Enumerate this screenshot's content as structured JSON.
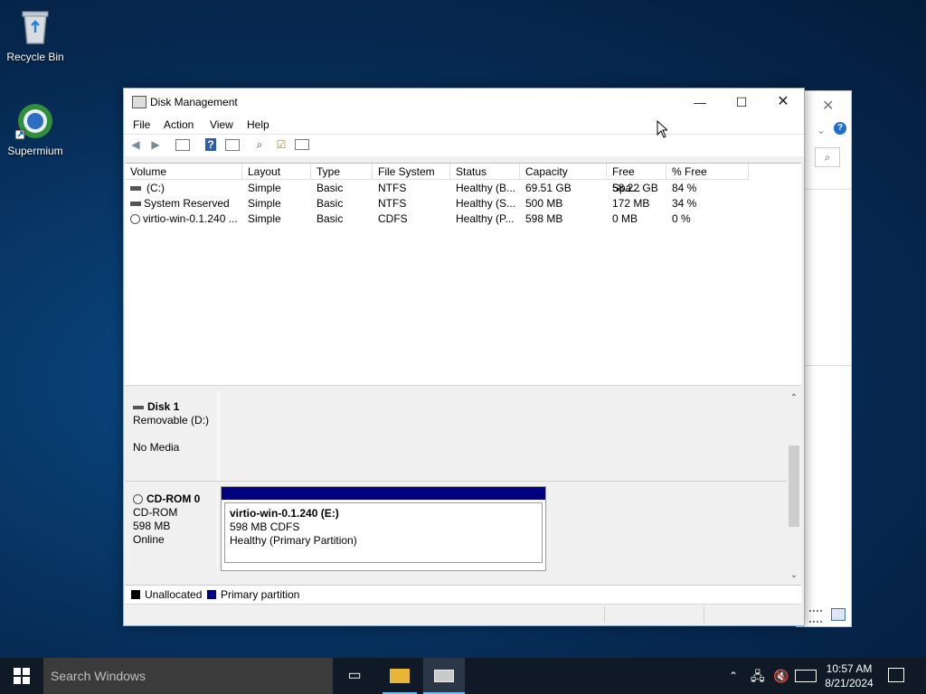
{
  "desktop": {
    "icons": [
      {
        "label": "Recycle Bin"
      },
      {
        "label": "Supermium"
      }
    ]
  },
  "window": {
    "title": "Disk Management",
    "menu": [
      "File",
      "Action",
      "View",
      "Help"
    ],
    "toolbar": [
      "back-icon",
      "forward-icon",
      "properties-icon",
      "help-icon",
      "console-tree-icon",
      "rescan-icon",
      "check-icon",
      "settings-icon"
    ]
  },
  "volumes": {
    "columns": [
      "Volume",
      "Layout",
      "Type",
      "File System",
      "Status",
      "Capacity",
      "Free Spa...",
      "% Free"
    ],
    "rows": [
      [
        "(C:)",
        "Simple",
        "Basic",
        "NTFS",
        "Healthy (B...",
        "69.51 GB",
        "58.22 GB",
        "84 %"
      ],
      [
        "System Reserved",
        "Simple",
        "Basic",
        "NTFS",
        "Healthy (S...",
        "500 MB",
        "172 MB",
        "34 %"
      ],
      [
        "virtio-win-0.1.240 ...",
        "Simple",
        "Basic",
        "CDFS",
        "Healthy (P...",
        "598 MB",
        "0 MB",
        "0 %"
      ]
    ]
  },
  "disks": [
    {
      "name": "Disk 1",
      "line1": "Removable (D:)",
      "line2": "",
      "line3": "No Media"
    },
    {
      "name": "CD-ROM 0",
      "line1": "CD-ROM",
      "line2": "598 MB",
      "line3": "Online"
    }
  ],
  "partition": {
    "title": "virtio-win-0.1.240  (E:)",
    "size": "598 MB CDFS",
    "status": "Healthy (Primary Partition)"
  },
  "legend": [
    {
      "label": "Unallocated",
      "color": "#000000"
    },
    {
      "label": "Primary partition",
      "color": "#000080"
    }
  ],
  "taskbar": {
    "search_placeholder": "Search Windows",
    "time": "10:57 AM",
    "date": "8/21/2024"
  },
  "colors": {
    "primary_partition": "#000080",
    "taskbar": "#101a26"
  }
}
